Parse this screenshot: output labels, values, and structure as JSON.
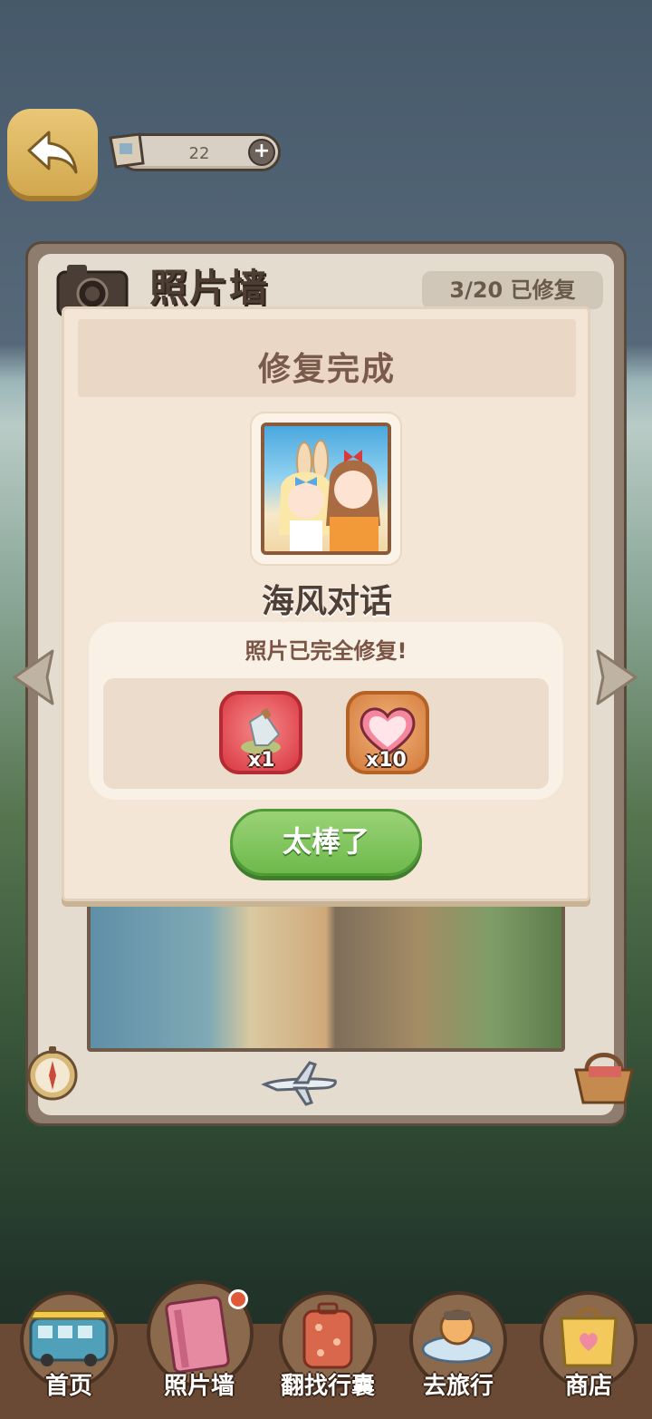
{
  "top_bar": {
    "counter_value": "22",
    "plus_label": "+"
  },
  "board": {
    "title": "照片墙",
    "progress": "3/20 已修复"
  },
  "modal": {
    "title": "修复完成",
    "photo_name": "海风对话",
    "subtitle": "照片已完全修复!",
    "rewards": [
      {
        "icon": "bottle-icon",
        "qty": "x1"
      },
      {
        "icon": "heart-icon",
        "qty": "x10"
      }
    ],
    "confirm_label": "太棒了"
  },
  "nav": {
    "items": [
      {
        "label": "首页",
        "icon": "bus-icon"
      },
      {
        "label": "照片墙",
        "icon": "album-icon",
        "active": true,
        "badge": true
      },
      {
        "label": "翻找行囊",
        "icon": "suitcase-icon"
      },
      {
        "label": "去旅行",
        "icon": "traveler-icon"
      },
      {
        "label": "商店",
        "icon": "shop-bag-icon"
      }
    ]
  },
  "colors": {
    "accent_green": "#6dba4b",
    "modal_bg": "#f3e6d6",
    "title_brown": "#7a5a4b",
    "badge_red": "#e05a3a"
  }
}
